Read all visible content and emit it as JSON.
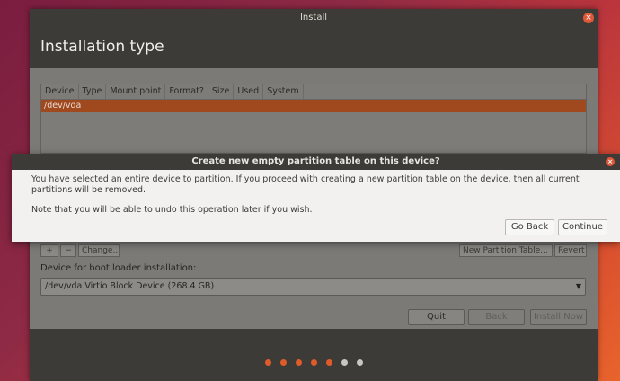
{
  "window": {
    "title": "Install",
    "close_glyph": "×",
    "page_title": "Installation type"
  },
  "partition_table": {
    "columns": [
      "Device",
      "Type",
      "Mount point",
      "Format?",
      "Size",
      "Used",
      "System"
    ],
    "rows": [
      {
        "device": "/dev/vda"
      }
    ]
  },
  "partition_buttons": {
    "add": "+",
    "remove": "−",
    "change": "Change...",
    "new_table": "New Partition Table...",
    "revert": "Revert"
  },
  "boot_loader": {
    "label": "Device for boot loader installation:",
    "selected": "/dev/vda Virtio Block Device (268.4 GB)",
    "arrow_glyph": "▼"
  },
  "navigation": {
    "quit": "Quit",
    "back": "Back",
    "install_now": "Install Now"
  },
  "progress_dots": {
    "total": 7,
    "completed": 5,
    "colors": {
      "done": "#e05b2a",
      "pending": "#c8c6c2"
    }
  },
  "dialog": {
    "title": "Create new empty partition table on this device?",
    "close_glyph": "×",
    "message": "You have selected an entire device to partition. If you proceed with creating a new partition table on the device, then all current partitions will be removed.",
    "note": "Note that you will be able to undo this operation later if you wish.",
    "go_back": "Go Back",
    "continue": "Continue"
  },
  "colors": {
    "accent": "#e95420",
    "selected_row": "#a0481e",
    "titlebar": "#3c3b37"
  }
}
